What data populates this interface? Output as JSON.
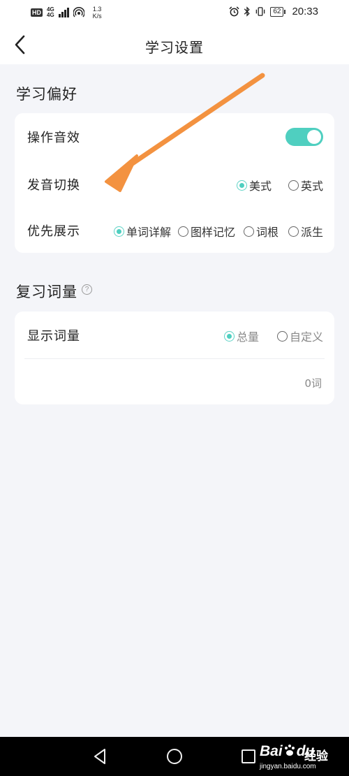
{
  "status_bar": {
    "hd": "HD",
    "signal_top": "4G",
    "signal_bottom": "4G",
    "net_speed_value": "1.3",
    "net_speed_unit": "K/s",
    "battery": "62",
    "time": "20:33"
  },
  "header": {
    "title": "学习设置"
  },
  "preferences": {
    "section_title": "学习偏好",
    "sound_effect_label": "操作音效",
    "sound_effect_on": true,
    "pronunciation_label": "发音切换",
    "pronunciation_options": [
      {
        "label": "美式",
        "selected": true
      },
      {
        "label": "英式",
        "selected": false
      }
    ],
    "display_label": "优先展示",
    "display_options": [
      {
        "label": "单词详解",
        "selected": true
      },
      {
        "label": "图样记忆",
        "selected": false
      },
      {
        "label": "词根",
        "selected": false
      },
      {
        "label": "派生",
        "selected": false
      }
    ]
  },
  "review": {
    "section_title": "复习词量",
    "help_icon": "?",
    "show_count_label": "显示词量",
    "count_options": [
      {
        "label": "总量",
        "selected": true
      },
      {
        "label": "自定义",
        "selected": false
      }
    ],
    "count_value": "0词"
  },
  "watermark": {
    "logo": "Bai",
    "logo_suffix": "du",
    "jingyan": "经验",
    "url": "jingyan.baidu.com"
  },
  "colors": {
    "accent": "#4fcfc0",
    "arrow": "#f39240"
  }
}
